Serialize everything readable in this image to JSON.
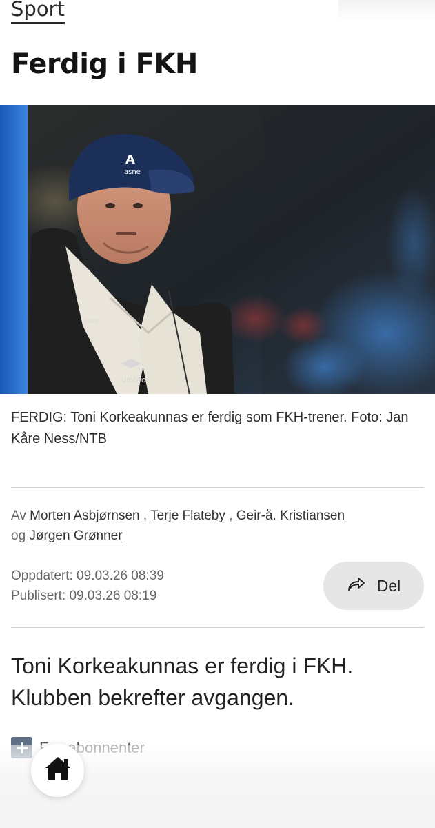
{
  "section": {
    "label": "Sport"
  },
  "article": {
    "title": "Ferdig i FKH",
    "image": {
      "description": "Toni Korkeakunnas i caps og vinterjakke"
    },
    "caption": "FERDIG: Toni Korkeakunnas er ferdig som FKH-trener. Foto: Jan Kåre Ness/NTB",
    "byline": {
      "prefix": "Av",
      "authors": [
        "Morten Asbjørnsen",
        "Terje Flateby",
        "Geir-å. Kristiansen",
        "Jørgen Grønner"
      ],
      "separator": ",",
      "conjunction": "og"
    },
    "updated": "Oppdatert: 09.03.26 08:39",
    "published": "Publisert: 09.03.26 08:19",
    "share_label": "Del",
    "lead": "Toni Korkeakunnas er ferdig i FKH. Klubben bekrefter avgangen.",
    "follow_label": "F… abonnenter"
  },
  "icons": {
    "share": "share-arrow-icon",
    "plus": "plus-icon",
    "home": "home-icon"
  },
  "colors": {
    "accent": "#5f6f86",
    "button_bg": "#e6e6e6",
    "text": "#1c1c1c",
    "muted": "#666666"
  }
}
